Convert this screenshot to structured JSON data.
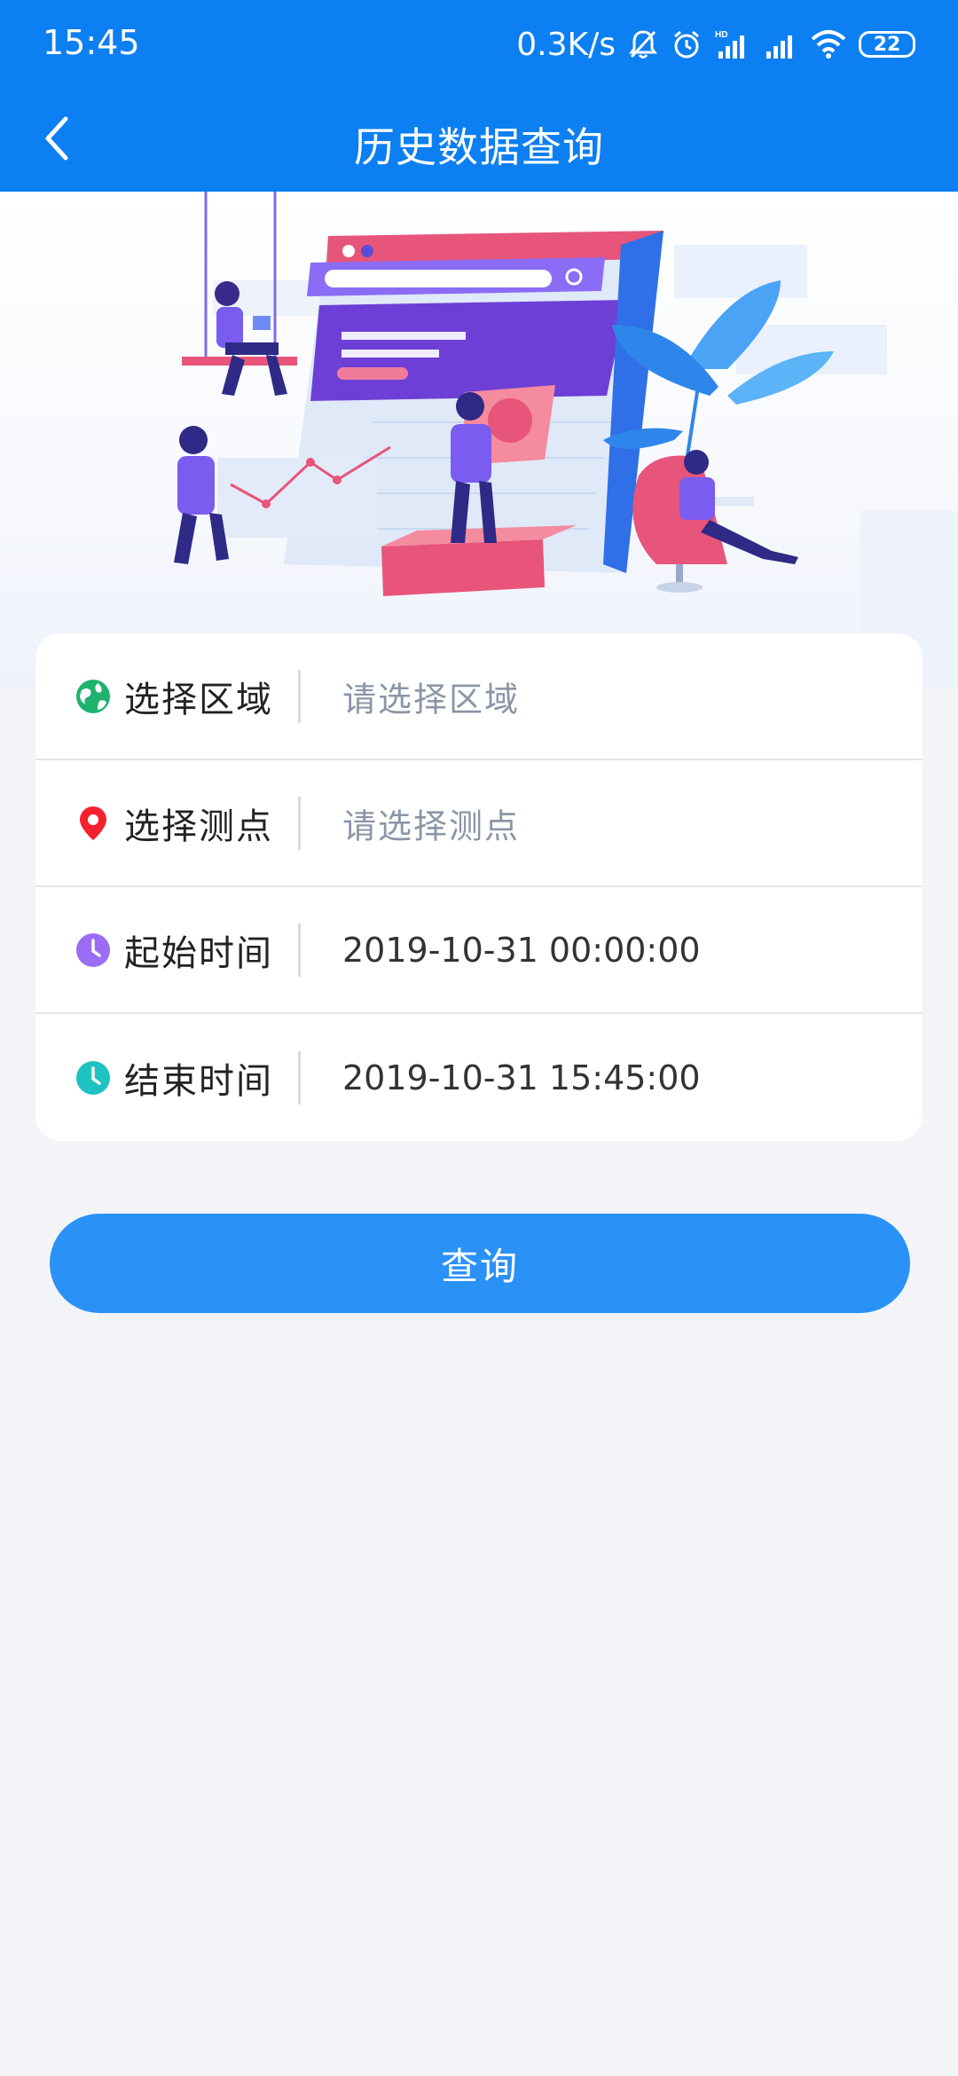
{
  "status_bar": {
    "time": "15:45",
    "net_speed": "0.3K/s",
    "battery": "22",
    "icons": [
      "bell-off-icon",
      "alarm-icon",
      "hd-signal-icon",
      "signal-icon",
      "wifi-icon",
      "battery-icon"
    ]
  },
  "header": {
    "title": "历史数据查询",
    "back_icon": "chevron-left-icon"
  },
  "form": {
    "region": {
      "label": "选择区域",
      "placeholder": "请选择区域",
      "icon": "globe-icon",
      "icon_color": "#1db36e"
    },
    "point": {
      "label": "选择测点",
      "placeholder": "请选择测点",
      "icon": "location-pin-icon",
      "icon_color": "#f5222d"
    },
    "start_time": {
      "label": "起始时间",
      "value": "2019-10-31 00:00:00",
      "icon": "clock-icon",
      "icon_color": "#9b6cf5"
    },
    "end_time": {
      "label": "结束时间",
      "value": "2019-10-31 15:45:00",
      "icon": "clock-icon",
      "icon_color": "#1fc2c2"
    }
  },
  "actions": {
    "query_label": "查询"
  },
  "colors": {
    "primary": "#0c7ff2",
    "button": "#2a91f7",
    "background": "#f3f4f7"
  }
}
